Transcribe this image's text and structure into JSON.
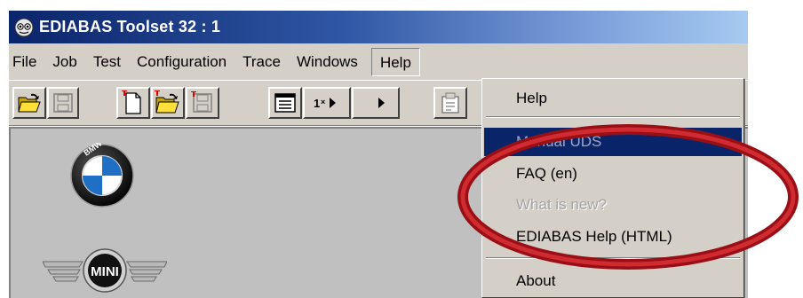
{
  "window": {
    "title": "EDIABAS Toolset 32 : 1"
  },
  "menubar": {
    "items": [
      {
        "label": "File"
      },
      {
        "label": "Job"
      },
      {
        "label": "Test"
      },
      {
        "label": "Configuration"
      },
      {
        "label": "Trace"
      },
      {
        "label": "Windows"
      },
      {
        "label": "Help"
      }
    ]
  },
  "toolbar": {
    "buttons": [
      {
        "icon": "open-folder-icon"
      },
      {
        "icon": "save-disk-icon"
      },
      {
        "icon": "new-document-icon"
      },
      {
        "icon": "open-folder-icon"
      },
      {
        "icon": "save-disk-icon"
      },
      {
        "icon": "result-list-icon"
      },
      {
        "icon": "step-run-icon"
      },
      {
        "icon": "play-icon"
      },
      {
        "icon": "properties-icon"
      }
    ]
  },
  "help_menu": {
    "items": [
      {
        "label": "Help",
        "state": "enabled"
      },
      {
        "label": "Manual UDS",
        "state": "highlighted-disabled"
      },
      {
        "label": "FAQ (en)",
        "state": "enabled"
      },
      {
        "label": "What is new?",
        "state": "disabled"
      },
      {
        "label": "EDIABAS Help (HTML)",
        "state": "enabled"
      },
      {
        "label": "About",
        "state": "enabled"
      }
    ]
  },
  "content": {
    "logos": [
      {
        "name": "bmw-logo",
        "text": "BMW"
      },
      {
        "name": "mini-logo",
        "text": "MINI"
      }
    ]
  },
  "colors": {
    "title_bar_start": "#0a246a",
    "title_bar_end": "#a6caf0",
    "face": "#d4d0c8",
    "highlight": "#0a246a",
    "annotation_ring": "#b0141c"
  }
}
